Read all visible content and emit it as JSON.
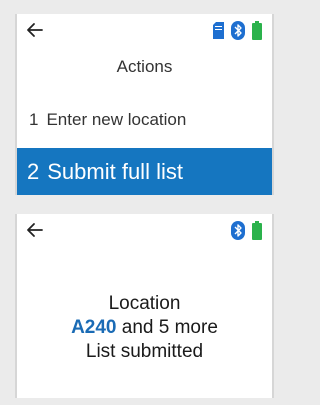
{
  "colors": {
    "accent": "#1576c0",
    "location_code": "#1a6bb5",
    "battery": "#2bb24c",
    "bluetooth": "#1e6fd0",
    "sd_card": "#1e6fd0",
    "background": "#ebebeb",
    "screen": "#ffffff"
  },
  "screen_actions": {
    "status_icons": [
      "back-arrow-icon",
      "sd-card-icon",
      "bluetooth-icon",
      "battery-icon"
    ],
    "title": "Actions",
    "items": [
      {
        "number": "1",
        "label": "Enter new location",
        "selected": false
      },
      {
        "number": "2",
        "label": "Submit full list",
        "selected": true
      }
    ]
  },
  "screen_confirmation": {
    "status_icons": [
      "back-arrow-icon",
      "bluetooth-icon",
      "battery-icon"
    ],
    "line1": "Location",
    "location_code": "A240",
    "more_text": "and 5 more",
    "line3": "List submitted"
  }
}
